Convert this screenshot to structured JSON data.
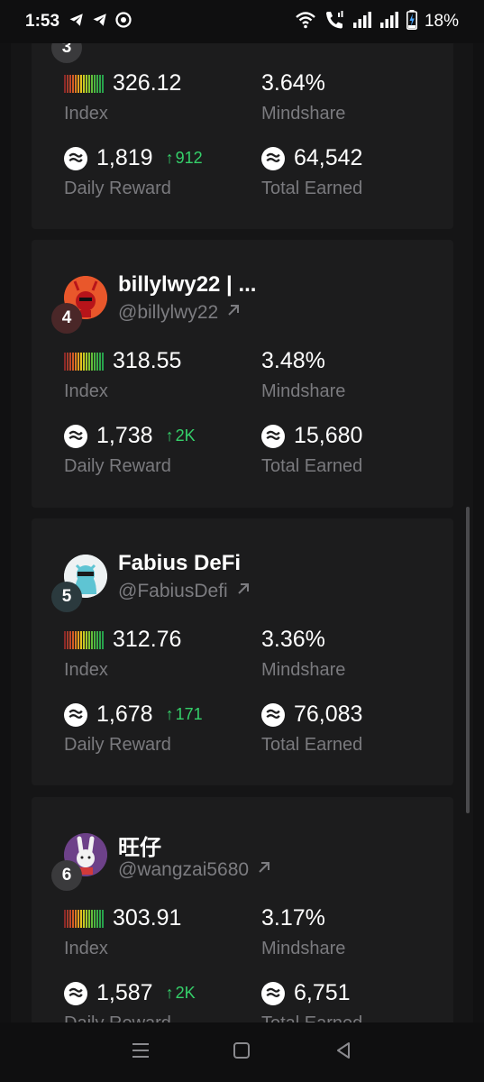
{
  "status_bar": {
    "time": "1:53",
    "battery": "18%",
    "left_icons": [
      "telegram-icon",
      "telegram-icon",
      "chrome-icon"
    ],
    "right_icons": [
      "wifi-icon",
      "wifi-call-icon",
      "signal-icon",
      "signal-icon",
      "battery-charging-icon"
    ]
  },
  "labels": {
    "index": "Index",
    "mindshare": "Mindshare",
    "daily_reward": "Daily Reward",
    "total_earned": "Total Earned"
  },
  "cards": [
    {
      "rank": "3",
      "index": "326.12",
      "mindshare": "3.64%",
      "daily_reward": "1,819",
      "daily_change": "912",
      "total_earned": "64,542",
      "labels": {
        "index": "Index",
        "mindshare": "Mindshare",
        "daily_reward": "Daily Reward",
        "total_earned": "Total Earned"
      }
    },
    {
      "rank": "4",
      "name": "billylwy22 | ...",
      "handle": "@billylwy22",
      "index": "318.55",
      "mindshare": "3.48%",
      "daily_reward": "1,738",
      "daily_change": "2K",
      "total_earned": "15,680",
      "labels": {
        "index": "Index",
        "mindshare": "Mindshare",
        "daily_reward": "Daily Reward",
        "total_earned": "Total Earned"
      }
    },
    {
      "rank": "5",
      "name": "Fabius DeFi",
      "handle": "@FabiusDefi",
      "index": "312.76",
      "mindshare": "3.36%",
      "daily_reward": "1,678",
      "daily_change": "171",
      "total_earned": "76,083",
      "labels": {
        "index": "Index",
        "mindshare": "Mindshare",
        "daily_reward": "Daily Reward",
        "total_earned": "Total Earned"
      }
    },
    {
      "rank": "6",
      "name": "旺仔",
      "handle": "@wangzai5680",
      "index": "303.91",
      "mindshare": "3.17%",
      "daily_reward": "1,587",
      "daily_change": "2K",
      "total_earned": "6,751",
      "labels": {
        "index": "Index",
        "mindshare": "Mindshare",
        "daily_reward": "Daily Reward",
        "total_earned": "Total Earned"
      }
    }
  ],
  "nav": {
    "icons": [
      "recent-apps-icon",
      "home-icon",
      "back-icon"
    ]
  },
  "colors": {
    "positive": "#35d06a",
    "card_bg": "#1c1c1d",
    "muted_text": "#7a7a7e"
  }
}
